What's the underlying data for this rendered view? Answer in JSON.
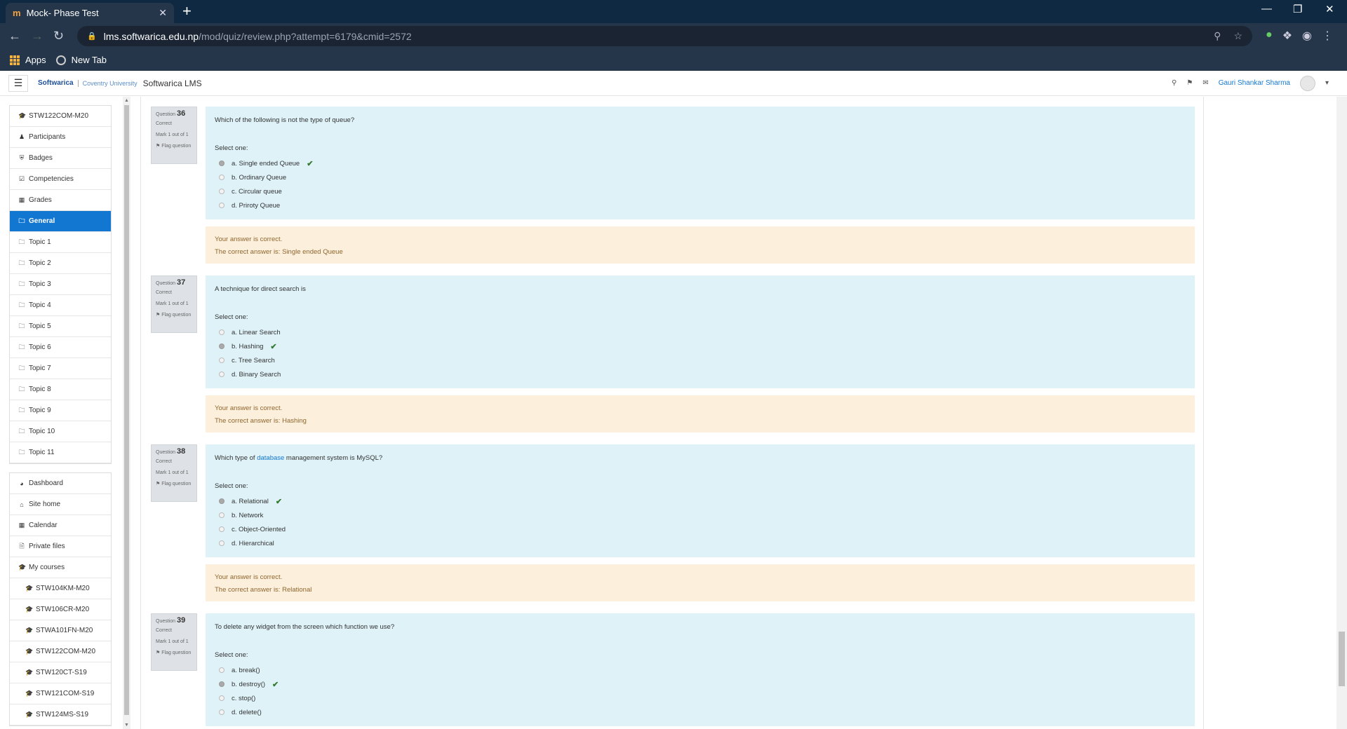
{
  "browser": {
    "tab_title": "Mock- Phase Test",
    "tab_favicon": "m",
    "new_tab": "+",
    "tab_close": "✕",
    "url_host": "lms.softwarica.edu.np",
    "url_path": "/mod/quiz/review.php?attempt=6179&cmid=2572",
    "bookmarks": [
      "Apps",
      "New Tab"
    ]
  },
  "header": {
    "logo_text": "Softwarica",
    "partner_text": "Coventry University",
    "site_name": "Softwarica LMS",
    "user_name": "Gauri Shankar Sharma"
  },
  "sidebar": {
    "course_nav": [
      {
        "label": "STW122COM-M20",
        "icon": "graduation-cap-icon"
      },
      {
        "label": "Participants",
        "icon": "users-icon"
      },
      {
        "label": "Badges",
        "icon": "shield-icon"
      },
      {
        "label": "Competencies",
        "icon": "check-square-icon"
      },
      {
        "label": "Grades",
        "icon": "table-icon"
      },
      {
        "label": "General",
        "icon": "folder-icon",
        "active": true
      },
      {
        "label": "Topic 1",
        "icon": "folder-icon"
      },
      {
        "label": "Topic 2",
        "icon": "folder-icon"
      },
      {
        "label": "Topic 3",
        "icon": "folder-icon"
      },
      {
        "label": "Topic 4",
        "icon": "folder-icon"
      },
      {
        "label": "Topic 5",
        "icon": "folder-icon"
      },
      {
        "label": "Topic 6",
        "icon": "folder-icon"
      },
      {
        "label": "Topic 7",
        "icon": "folder-icon"
      },
      {
        "label": "Topic 8",
        "icon": "folder-icon"
      },
      {
        "label": "Topic 9",
        "icon": "folder-icon"
      },
      {
        "label": "Topic 10",
        "icon": "folder-icon"
      },
      {
        "label": "Topic 11",
        "icon": "folder-icon"
      }
    ],
    "site_nav": [
      {
        "label": "Dashboard",
        "icon": "dashboard-icon"
      },
      {
        "label": "Site home",
        "icon": "home-icon"
      },
      {
        "label": "Calendar",
        "icon": "calendar-icon"
      },
      {
        "label": "Private files",
        "icon": "file-icon"
      },
      {
        "label": "My courses",
        "icon": "graduation-cap-icon"
      },
      {
        "label": "STW104KM-M20",
        "icon": "graduation-cap-icon",
        "sub": true
      },
      {
        "label": "STW106CR-M20",
        "icon": "graduation-cap-icon",
        "sub": true
      },
      {
        "label": "STWA101FN-M20",
        "icon": "graduation-cap-icon",
        "sub": true
      },
      {
        "label": "STW122COM-M20",
        "icon": "graduation-cap-icon",
        "sub": true
      },
      {
        "label": "STW120CT-S19",
        "icon": "graduation-cap-icon",
        "sub": true
      },
      {
        "label": "STW121COM-S19",
        "icon": "graduation-cap-icon",
        "sub": true
      },
      {
        "label": "STW124MS-S19",
        "icon": "graduation-cap-icon",
        "sub": true
      }
    ]
  },
  "quiz": {
    "question_label": "Question",
    "state_label": "Correct",
    "mark_label": "Mark 1 out of 1",
    "flag_label": "Flag question",
    "select_one": "Select one:",
    "feedback_correct": "Your answer is correct.",
    "correct_answer_prefix": "The correct answer is: ",
    "questions": [
      {
        "number": "36",
        "text": "Which of the following is not the type of queue?",
        "options": [
          "a. Single ended Queue",
          "b. Ordinary Queue",
          "c. Circular queue",
          "d. Priroty Queue"
        ],
        "selected": 0,
        "correct_answer": "Single ended Queue"
      },
      {
        "number": "37",
        "text": "A technique for direct search is",
        "options": [
          "a. Linear Search",
          "b. Hashing",
          "c. Tree Search",
          "d. Binary Search"
        ],
        "selected": 1,
        "correct_answer": "Hashing"
      },
      {
        "number": "38",
        "text_before": "Which type of ",
        "text_link": "database",
        "text_after": " management system is MySQL?",
        "options": [
          "a. Relational",
          "b. Network",
          "c. Object-Oriented",
          "d. Hierarchical"
        ],
        "selected": 0,
        "correct_answer": "Relational"
      },
      {
        "number": "39",
        "text": "To delete any widget from the screen which function we use?",
        "options": [
          "a. break()",
          "b. destroy()",
          "c. stop()",
          "d. delete()"
        ],
        "selected": 1,
        "correct_answer": ""
      }
    ]
  }
}
